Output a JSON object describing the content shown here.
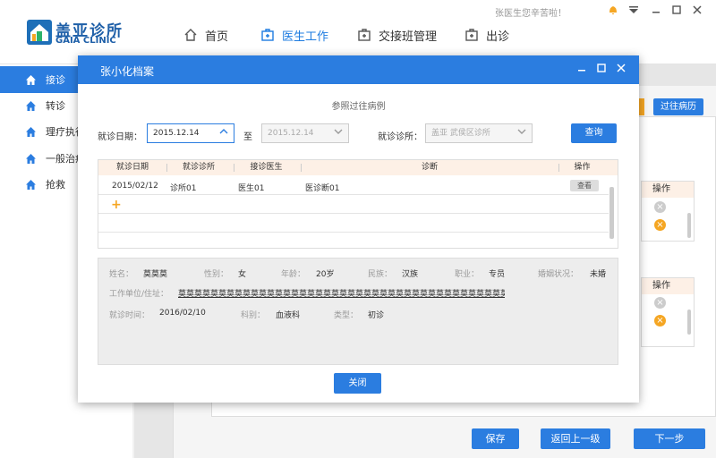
{
  "header": {
    "logo_cn": "盖亚诊所",
    "logo_en": "GAIA CLINIC",
    "greeting": "张医生您辛苦啦！",
    "nav": [
      {
        "label": "首页",
        "icon": "home-icon"
      },
      {
        "label": "医生工作",
        "icon": "medical-kit-icon"
      },
      {
        "label": "交接班管理",
        "icon": "medical-kit-icon"
      },
      {
        "label": "出诊",
        "icon": "medical-kit-icon"
      }
    ]
  },
  "sidebar": {
    "items": [
      {
        "label": "接诊",
        "icon": "home-icon"
      },
      {
        "label": "转诊",
        "icon": "home-icon"
      },
      {
        "label": "理疗执行",
        "icon": "home-icon"
      },
      {
        "label": "一般治疗",
        "icon": "home-icon"
      },
      {
        "label": "抢救",
        "icon": "home-icon"
      }
    ]
  },
  "background": {
    "history_button": "过往病历",
    "action_header": "操作",
    "bottom_buttons": [
      "保存",
      "返回上一级",
      "下一步"
    ]
  },
  "modal": {
    "title": "张小化档案",
    "subtitle": "参照过往病例",
    "filter": {
      "date_label": "就诊日期：",
      "date_from": "2015.12.14",
      "to_label": "至",
      "date_to": "2015.12.14",
      "clinic_label": "就诊诊所：",
      "clinic_value": "盖亚 武侯区诊所",
      "query_button": "查询"
    },
    "table": {
      "headers": [
        "就诊日期",
        "就诊诊所",
        "接诊医生",
        "诊断",
        "操作"
      ],
      "rows": [
        {
          "date": "2015/02/12",
          "clinic": "诊所01",
          "doctor": "医生01",
          "diagnosis": "医诊断01",
          "action": "查看"
        }
      ]
    },
    "detail": {
      "name_label": "姓名：",
      "name": "莫莫莫",
      "gender_label": "性别：",
      "gender": "女",
      "age_label": "年龄：",
      "age": "20岁",
      "ethnicity_label": "民族：",
      "ethnicity": "汉族",
      "job_label": "职业：",
      "job": "专员",
      "marital_label": "婚姻状况：",
      "marital": "未婚",
      "address_label": "工作单位/住址：",
      "address": "莫莫莫莫莫莫莫莫莫莫莫莫莫莫莫莫莫莫莫莫莫莫莫莫莫莫莫莫莫莫莫莫莫莫莫莫莫莫莫莫莫莫莫莫莫",
      "visit_time_label": "就诊时间：",
      "visit_time": "2016/02/10",
      "department_label": "科别：",
      "department": "血液科",
      "type_label": "类型：",
      "type": "初诊"
    },
    "close_button": "关闭"
  },
  "colors": {
    "primary": "#2b7de0",
    "accent": "#f5a623",
    "table_header": "#fdf0e6"
  }
}
